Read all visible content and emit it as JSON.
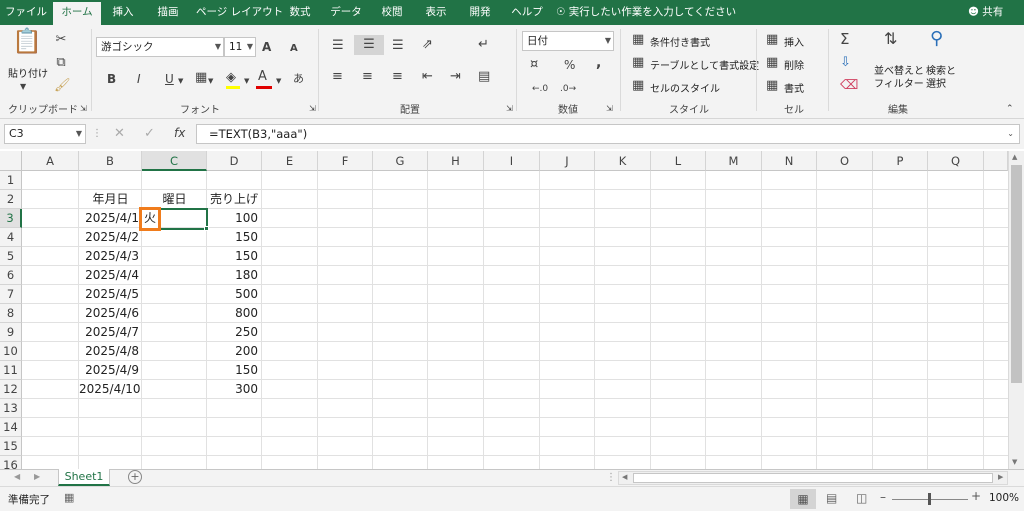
{
  "tabs": [
    "ファイル",
    "ホーム",
    "挿入",
    "描画",
    "ページ レイアウト",
    "数式",
    "データ",
    "校閲",
    "表示",
    "開発",
    "ヘルプ"
  ],
  "tell_me": "実行したい作業を入力してください",
  "share": "共有",
  "clipboard": {
    "paste": "貼り付け",
    "group": "クリップボード"
  },
  "font": {
    "name": "游ゴシック",
    "size": "11",
    "group": "フォント",
    "bold": "B",
    "italic": "I",
    "underline": "U",
    "grow": "A",
    "shrink": "A",
    "color_a": "A"
  },
  "alignment": {
    "group": "配置"
  },
  "number": {
    "format": "日付",
    "group": "数値",
    "percent": "%",
    "comma": ","
  },
  "styles": {
    "conditional": "条件付き書式",
    "table": "テーブルとして書式設定",
    "cell": "セルのスタイル",
    "group": "スタイル"
  },
  "cells": {
    "insert": "挿入",
    "delete": "削除",
    "format": "書式",
    "group": "セル"
  },
  "editing": {
    "sort": [
      "並べ替えと",
      "フィルター"
    ],
    "find": [
      "検索と",
      "選択"
    ],
    "group": "編集"
  },
  "formula_bar": {
    "name_box": "C3",
    "formula": "=TEXT(B3,\"aaa\")",
    "fx": "fx"
  },
  "columns": [
    "A",
    "B",
    "C",
    "D",
    "E",
    "F",
    "G",
    "H",
    "I",
    "J",
    "K",
    "L",
    "M",
    "N",
    "O",
    "P",
    "Q"
  ],
  "rows": [
    "1",
    "2",
    "3",
    "4",
    "5",
    "6",
    "7",
    "8",
    "9",
    "10",
    "11",
    "12",
    "13",
    "14",
    "15",
    "16"
  ],
  "headers": {
    "b": "年月日",
    "c": "曜日",
    "d": "売り上げ"
  },
  "data_rows": [
    {
      "date": "2025/4/1",
      "day": "火",
      "sales": "100"
    },
    {
      "date": "2025/4/2",
      "sales": "150"
    },
    {
      "date": "2025/4/3",
      "sales": "150"
    },
    {
      "date": "2025/4/4",
      "sales": "180"
    },
    {
      "date": "2025/4/5",
      "sales": "500"
    },
    {
      "date": "2025/4/6",
      "sales": "800"
    },
    {
      "date": "2025/4/7",
      "sales": "250"
    },
    {
      "date": "2025/4/8",
      "sales": "200"
    },
    {
      "date": "2025/4/9",
      "sales": "150"
    },
    {
      "date": "2025/4/10",
      "sales": "300"
    }
  ],
  "sheet": "Sheet1",
  "status": "準備完了",
  "zoom": "100%",
  "colors": {
    "accent": "#217346",
    "highlight": "#f07c1c"
  }
}
